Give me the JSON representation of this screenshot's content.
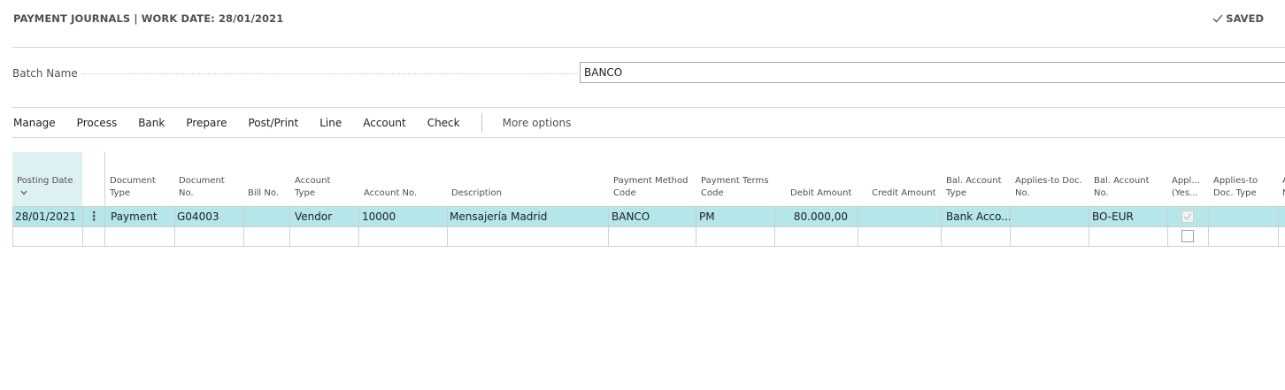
{
  "header": {
    "title": "PAYMENT JOURNALS | WORK DATE: 28/01/2021",
    "status": "SAVED"
  },
  "batch": {
    "label": "Batch Name",
    "value": "BANCO"
  },
  "menu": {
    "items": [
      "Manage",
      "Process",
      "Bank",
      "Prepare",
      "Post/Print",
      "Line",
      "Account",
      "Check"
    ],
    "more": "More options"
  },
  "table": {
    "columns": [
      {
        "line1": "",
        "line2": "Posting Date"
      },
      {
        "line1": "Document",
        "line2": "Type"
      },
      {
        "line1": "Document",
        "line2": "No."
      },
      {
        "line1": "",
        "line2": "Bill No."
      },
      {
        "line1": "Account",
        "line2": "Type"
      },
      {
        "line1": "",
        "line2": "Account No."
      },
      {
        "line1": "",
        "line2": "Description"
      },
      {
        "line1": "Payment Method",
        "line2": "Code"
      },
      {
        "line1": "Payment Terms",
        "line2": "Code"
      },
      {
        "line1": "",
        "line2": "Debit Amount"
      },
      {
        "line1": "",
        "line2": "Credit Amount"
      },
      {
        "line1": "Bal. Account",
        "line2": "Type"
      },
      {
        "line1": "Applies-to Doc.",
        "line2": "No."
      },
      {
        "line1": "Bal. Account",
        "line2": "No."
      },
      {
        "line1": "Appl...",
        "line2": "(Yes..."
      },
      {
        "line1": "Applies-to",
        "line2": "Doc. Type"
      },
      {
        "line1": "A",
        "line2": "N"
      }
    ],
    "rows": [
      {
        "posting_date": "28/01/2021",
        "document_type": "Payment",
        "document_no": "G04003",
        "bill_no": "",
        "account_type": "Vendor",
        "account_no": "10000",
        "description": "Mensajería Madrid",
        "payment_method_code": "BANCO",
        "payment_terms_code": "PM",
        "debit_amount": "80.000,00",
        "credit_amount": "",
        "bal_account_type": "Bank Acco...",
        "applies_to_doc_no": "",
        "bal_account_no": "BO-EUR",
        "applies_to_doc_type": ""
      }
    ]
  }
}
